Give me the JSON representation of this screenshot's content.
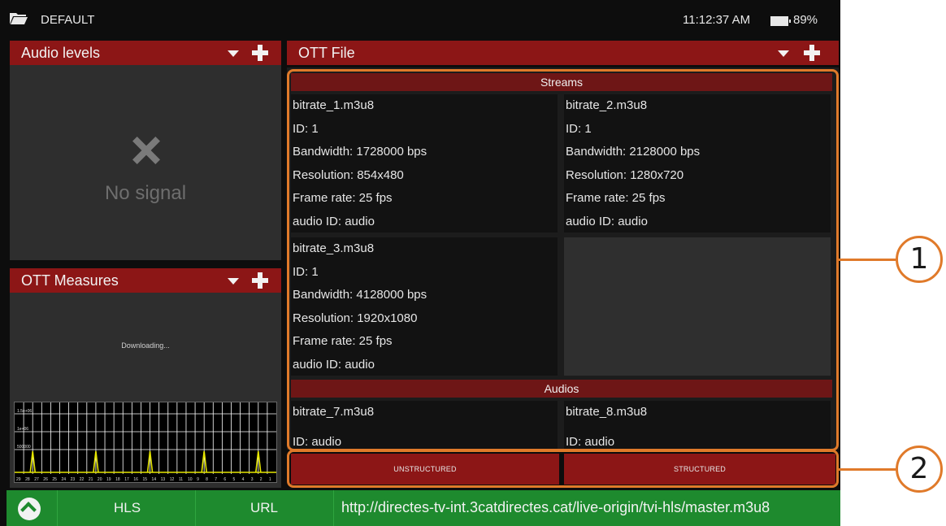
{
  "status_bar": {
    "profile": "DEFAULT",
    "time": "11:12:37 AM",
    "battery": "89%"
  },
  "audio_levels": {
    "title": "Audio levels",
    "message": "No signal"
  },
  "ott_measures": {
    "title": "OTT Measures",
    "status": "Downloading...",
    "graph": {
      "y_labels": [
        "1.5e+06",
        "1e+06",
        "500000"
      ],
      "x_labels": [
        "29",
        "28",
        "27",
        "26",
        "25",
        "24",
        "23",
        "22",
        "21",
        "20",
        "19",
        "18",
        "17",
        "16",
        "15",
        "14",
        "13",
        "12",
        "11",
        "10",
        "9",
        "8",
        "7",
        "6",
        "5",
        "4",
        "3",
        "2",
        "1"
      ],
      "spike_positions": [
        27,
        21,
        15,
        9,
        2
      ]
    }
  },
  "ott_file": {
    "title": "OTT File",
    "streams_header": "Streams",
    "streams": [
      {
        "name": "bitrate_1.m3u8",
        "id": "ID: 1",
        "bandwidth": "Bandwidth: 1728000 bps",
        "resolution": "Resolution: 854x480",
        "frame_rate": "Frame rate: 25 fps",
        "audio": "audio ID: audio"
      },
      {
        "name": "bitrate_2.m3u8",
        "id": "ID: 1",
        "bandwidth": "Bandwidth: 2128000 bps",
        "resolution": "Resolution: 1280x720",
        "frame_rate": "Frame rate: 25 fps",
        "audio": "audio ID: audio"
      },
      {
        "name": "bitrate_3.m3u8",
        "id": "ID: 1",
        "bandwidth": "Bandwidth: 4128000 bps",
        "resolution": "Resolution: 1920x1080",
        "frame_rate": "Frame rate: 25 fps",
        "audio": "audio ID: audio"
      }
    ],
    "audios_header": "Audios",
    "audios": [
      {
        "name": "bitrate_7.m3u8",
        "id": "ID: audio"
      },
      {
        "name": "bitrate_8.m3u8",
        "id": "ID: audio"
      }
    ],
    "buttons": {
      "unstructured": "UNSTRUCTURED",
      "structured": "STRUCTURED"
    }
  },
  "bottom_bar": {
    "protocol": "HLS",
    "source": "URL",
    "url": "http://directes-tv-int.3catdirectes.cat/live-origin/tvi-hls/master.m3u8"
  },
  "callouts": {
    "one": "1",
    "two": "2"
  },
  "colors": {
    "header_red": "#8c1616",
    "highlight_orange": "#e07a2a",
    "bar_green": "#1e8a2e",
    "graph_yellow": "#e6e600"
  }
}
